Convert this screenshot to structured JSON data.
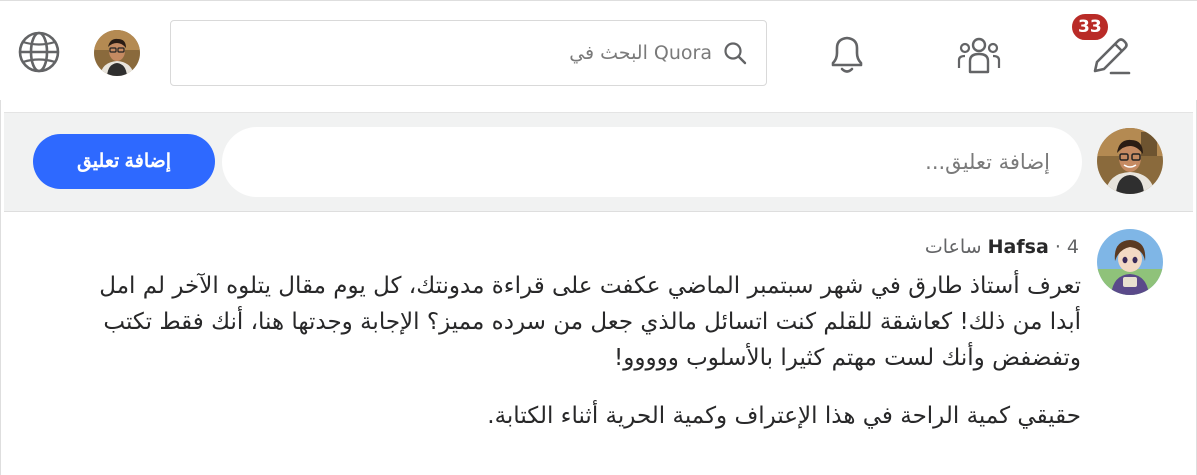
{
  "header": {
    "search_placeholder": "البحث في Quora",
    "notification_badge": "33",
    "icons": [
      "globe-icon",
      "avatar",
      "search-icon",
      "bell-icon",
      "people-icon",
      "edit-icon"
    ]
  },
  "comment_bar": {
    "input_placeholder": "إضافة تعليق...",
    "add_button_label": "إضافة تعليق"
  },
  "comment": {
    "author": "Hafsa",
    "separator": "·",
    "time": "4 ساعات",
    "paragraphs": [
      "تعرف أستاذ طارق في شهر سبتمبر الماضي عكفت على قراءة مدونتك، كل يوم مقال يتلوه الآخر لم امل أبدا من ذلك! كعاشقة للقلم كنت اتسائل مالذي جعل من سرده مميز؟ الإجابة وجدتها هنا، أنك فقط تكتب وتفضفض وأنك لست مهتم كثيرا بالأسلوب ووووو!",
      "حقيقي كمية الراحة في هذا الإعتراف وكمية الحرية أثناء الكتابة."
    ]
  },
  "colors": {
    "brand_red": "#b92b27",
    "primary_blue": "#2e69ff",
    "text": "#282829",
    "muted": "#636466"
  }
}
